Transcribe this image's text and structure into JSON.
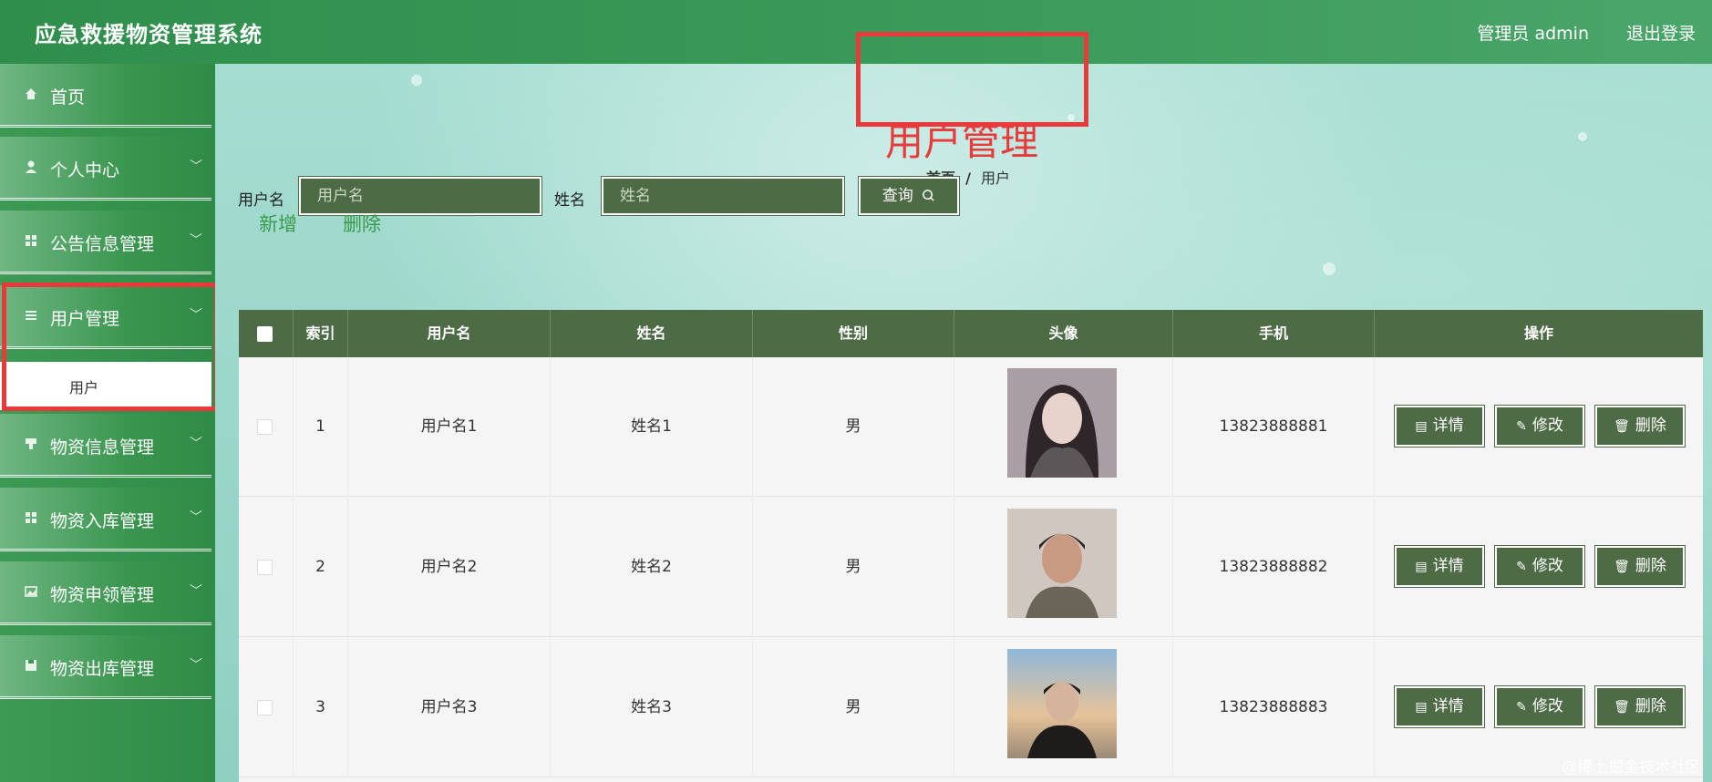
{
  "header": {
    "app_title": "应急救援物资管理系统",
    "admin_label": "管理员 admin",
    "logout_label": "退出登录"
  },
  "sidebar": {
    "items": [
      {
        "label": "首页",
        "icon": "home-icon",
        "has_children": false
      },
      {
        "label": "个人中心",
        "icon": "user-icon",
        "has_children": true
      },
      {
        "label": "公告信息管理",
        "icon": "grid-icon",
        "has_children": true
      },
      {
        "label": "用户管理",
        "icon": "menu-lines-icon",
        "has_children": true,
        "expanded": true
      },
      {
        "label": "物资信息管理",
        "icon": "bookmark-icon",
        "has_children": true
      },
      {
        "label": "物资入库管理",
        "icon": "grid-icon",
        "has_children": true
      },
      {
        "label": "物资申领管理",
        "icon": "image-icon",
        "has_children": true
      },
      {
        "label": "物资出库管理",
        "icon": "save-icon",
        "has_children": true
      }
    ],
    "submenu": {
      "label": "用户"
    }
  },
  "page": {
    "title": "用户管理",
    "breadcrumb_home": "首页",
    "breadcrumb_sep": "/",
    "breadcrumb_current": "用户"
  },
  "search": {
    "username_label": "用户名",
    "username_placeholder": "用户名",
    "name_label": "姓名",
    "name_placeholder": "姓名",
    "query_label": "查询"
  },
  "actions": {
    "add_label": "新增",
    "delete_label": "删除"
  },
  "table": {
    "columns": [
      "索引",
      "用户名",
      "姓名",
      "性别",
      "头像",
      "手机",
      "操作"
    ],
    "rows": [
      {
        "index": "1",
        "username": "用户名1",
        "name": "姓名1",
        "gender": "男",
        "phone": "13823888881"
      },
      {
        "index": "2",
        "username": "用户名2",
        "name": "姓名2",
        "gender": "男",
        "phone": "13823888882"
      },
      {
        "index": "3",
        "username": "用户名3",
        "name": "姓名3",
        "gender": "男",
        "phone": "13823888883"
      }
    ],
    "row_actions": {
      "detail_label": "详情",
      "edit_label": "修改",
      "delete_label": "删除"
    }
  },
  "watermark": "@稀土掘金技术社区",
  "colors": {
    "header_green": "#2f8e4c",
    "table_header": "#4d6b44",
    "highlight_red": "#e83a3a",
    "link_green": "#3b9a4c"
  }
}
